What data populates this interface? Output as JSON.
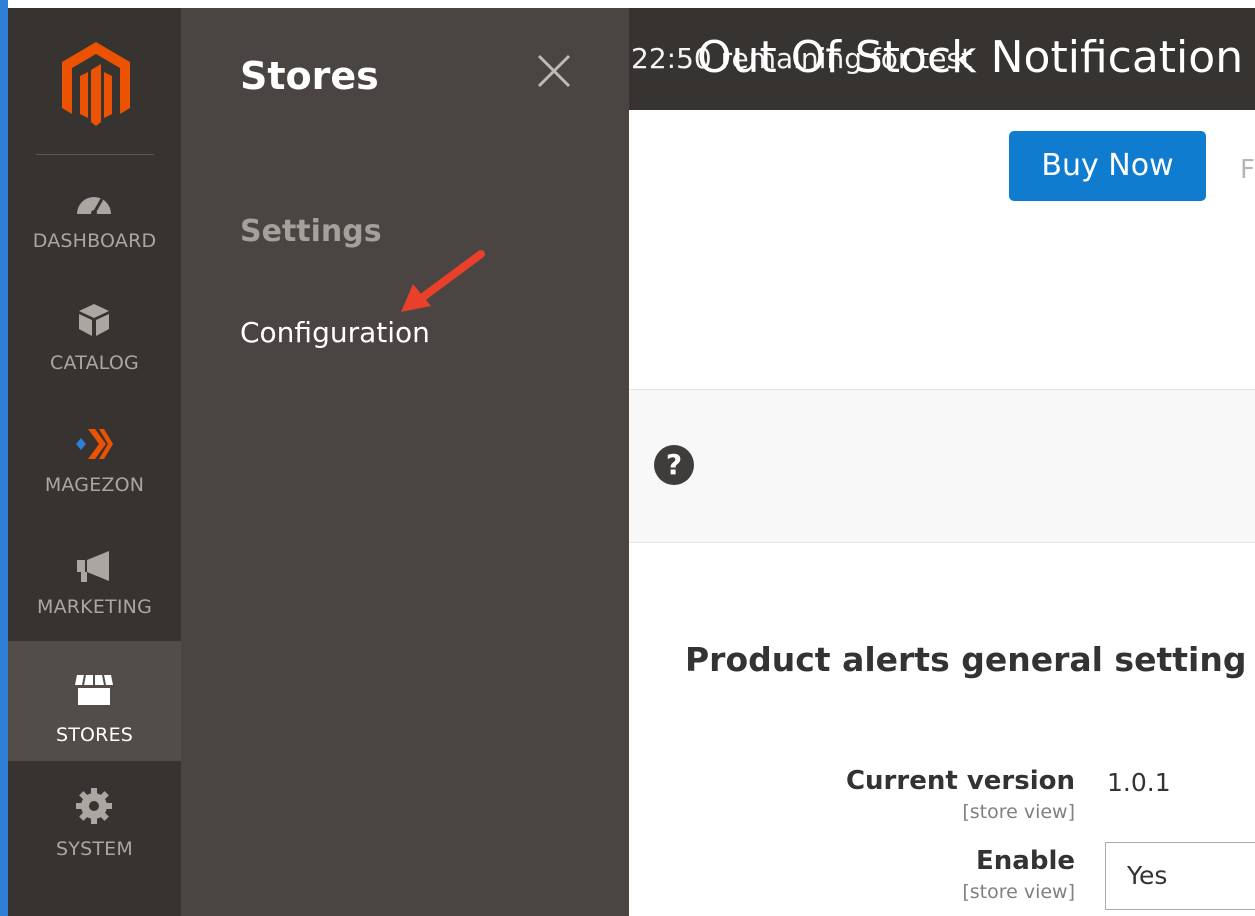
{
  "sidebar": {
    "logo_icon": "magento-logo-icon",
    "items": [
      {
        "label": "DASHBOARD",
        "icon": "dashboard-gauge-icon"
      },
      {
        "label": "CATALOG",
        "icon": "catalog-box-icon"
      },
      {
        "label": "MAGEZON",
        "icon": "magezon-chevrons-icon"
      },
      {
        "label": "MARKETING",
        "icon": "megaphone-icon"
      },
      {
        "label": "STORES",
        "icon": "store-icon",
        "active": true
      },
      {
        "label": "SYSTEM",
        "icon": "gear-icon"
      }
    ]
  },
  "flyout": {
    "title": "Stores",
    "section": "Settings",
    "link": "Configuration",
    "close_icon": "close-icon"
  },
  "header": {
    "title": "Out Of Stock Notification",
    "timer": "22:50 remaining for test"
  },
  "actions": {
    "buy_label": "Buy Now",
    "cut_label": "F"
  },
  "help": {
    "icon_label": "?"
  },
  "section": {
    "title": "Product alerts general setting",
    "fields": [
      {
        "label": "Current version",
        "scope": "[store view]",
        "value": "1.0.1"
      },
      {
        "label": "Enable",
        "scope": "[store view]",
        "value": "Yes"
      }
    ]
  },
  "colors": {
    "sidebar_bg": "#373330",
    "flyout_bg": "#4a4542",
    "accent_orange": "#eb5202",
    "button_blue": "#0f7cd0",
    "annotation_arrow": "#e8402a"
  }
}
